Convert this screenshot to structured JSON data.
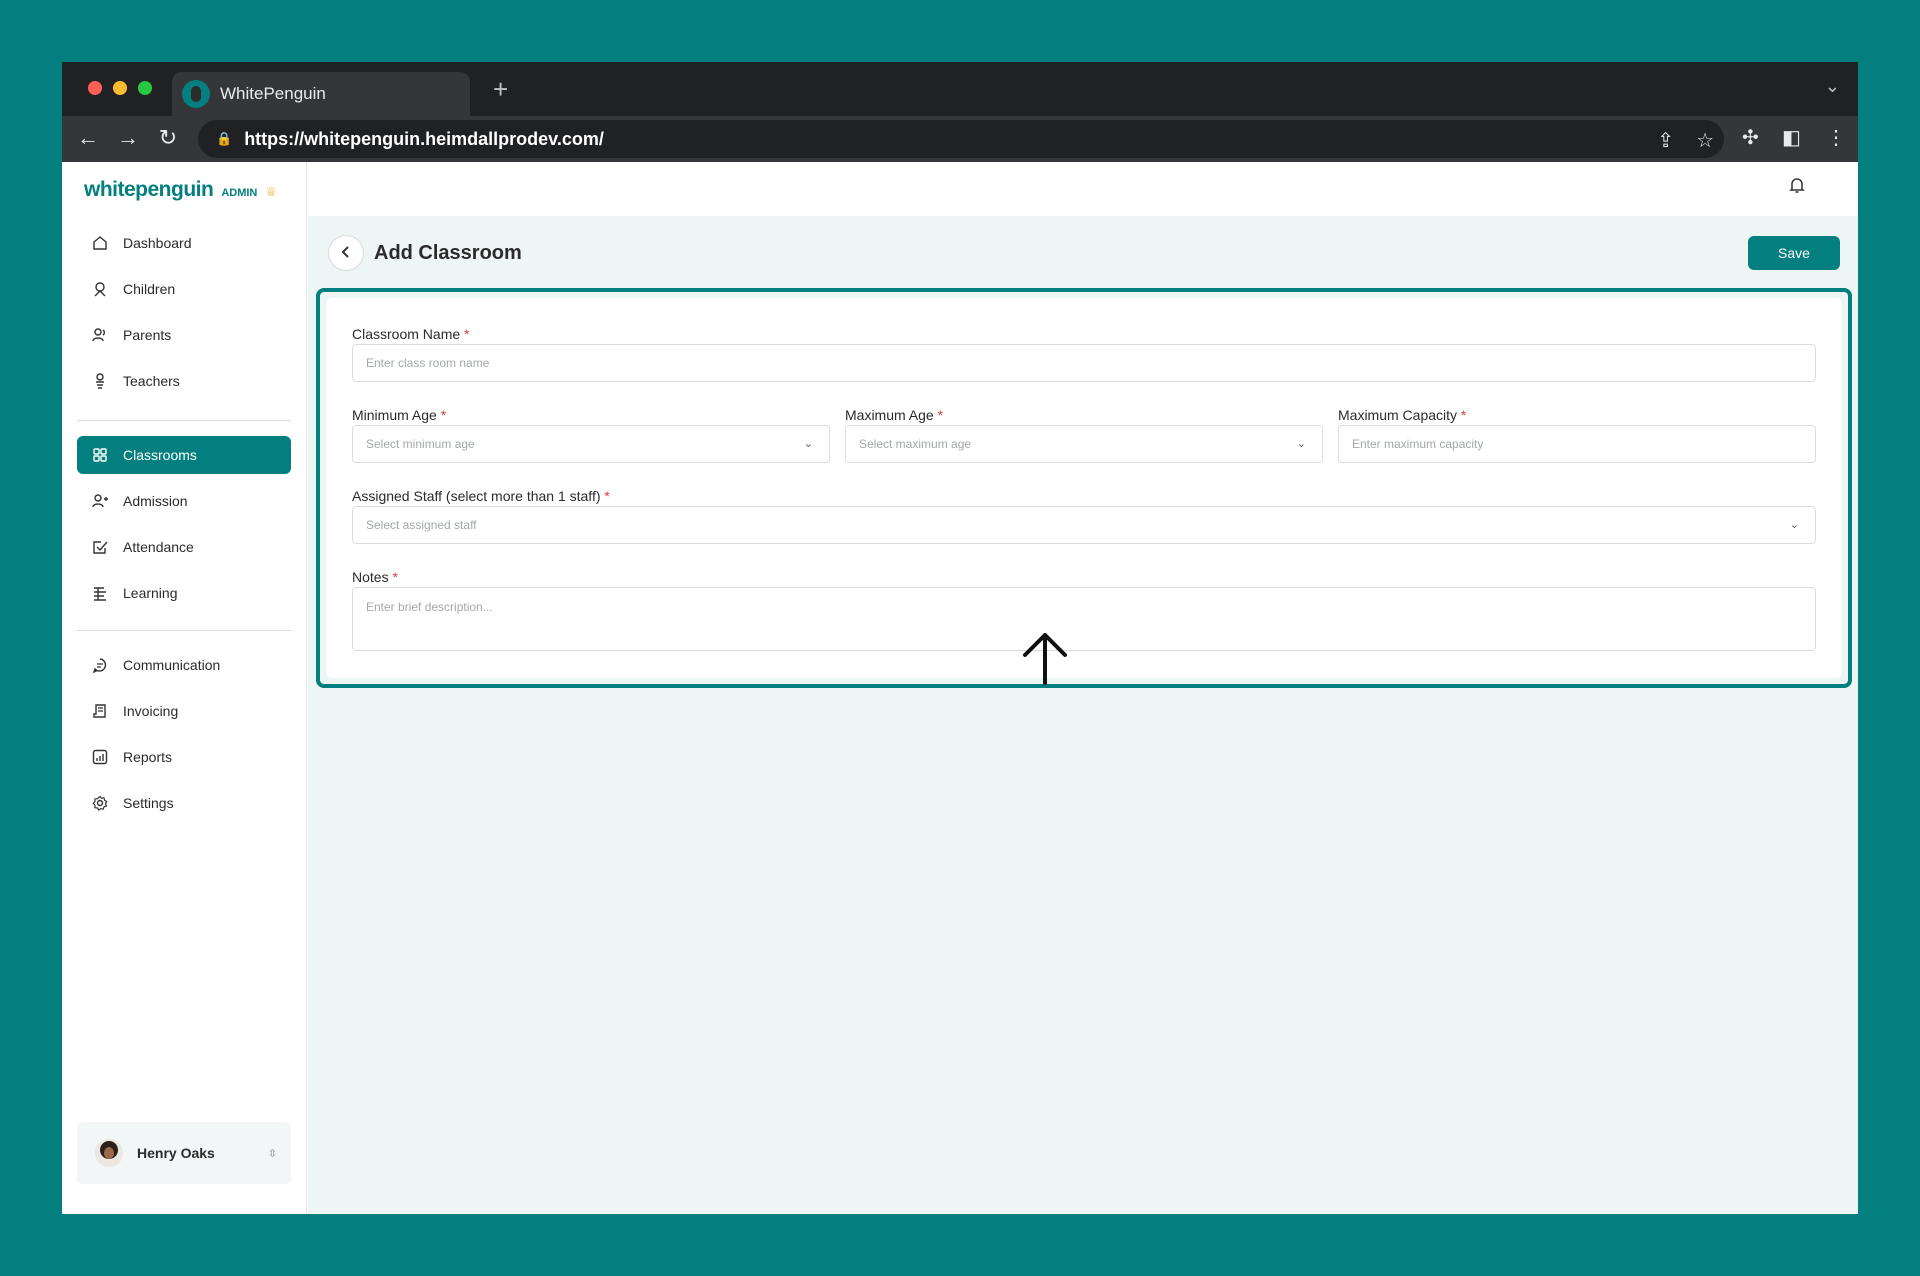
{
  "browser": {
    "tab_title": "WhitePenguin",
    "url": "https://whitepenguin.heimdallprodev.com/",
    "traffic_colors": [
      "#ff5f57",
      "#febc2e",
      "#28c840"
    ]
  },
  "brand": {
    "logo": "whitepenguin",
    "role": "ADMIN"
  },
  "sidebar": {
    "group1": [
      {
        "label": "Dashboard",
        "icon": "home-icon"
      },
      {
        "label": "Children",
        "icon": "child-icon"
      },
      {
        "label": "Parents",
        "icon": "parents-icon"
      },
      {
        "label": "Teachers",
        "icon": "teacher-icon"
      }
    ],
    "group2": [
      {
        "label": "Classrooms",
        "icon": "grid-icon",
        "active": true
      },
      {
        "label": "Admission",
        "icon": "user-add-icon"
      },
      {
        "label": "Attendance",
        "icon": "check-square-icon"
      },
      {
        "label": "Learning",
        "icon": "book-icon"
      }
    ],
    "group3": [
      {
        "label": "Communication",
        "icon": "chat-icon"
      },
      {
        "label": "Invoicing",
        "icon": "invoice-icon"
      },
      {
        "label": "Reports",
        "icon": "chart-icon"
      },
      {
        "label": "Settings",
        "icon": "gear-icon"
      }
    ],
    "user": {
      "name": "Henry Oaks"
    }
  },
  "page": {
    "title": "Add Classroom",
    "save_label": "Save"
  },
  "form": {
    "classroom_name": {
      "label": "Classroom Name",
      "placeholder": "Enter class room name"
    },
    "min_age": {
      "label": "Minimum Age",
      "placeholder": "Select minimum age"
    },
    "max_age": {
      "label": "Maximum Age",
      "placeholder": "Select maximum age"
    },
    "max_capacity": {
      "label": "Maximum Capacity",
      "placeholder": "Enter maximum capacity"
    },
    "staff": {
      "label": "Assigned Staff (select more than 1 staff)",
      "placeholder": "Select assigned staff"
    },
    "notes": {
      "label": "Notes",
      "placeholder": "Enter brief description..."
    },
    "required_mark": "*"
  },
  "colors": {
    "brand": "#037f7f",
    "required": "#e03a3a",
    "background": "#edf5f5"
  }
}
